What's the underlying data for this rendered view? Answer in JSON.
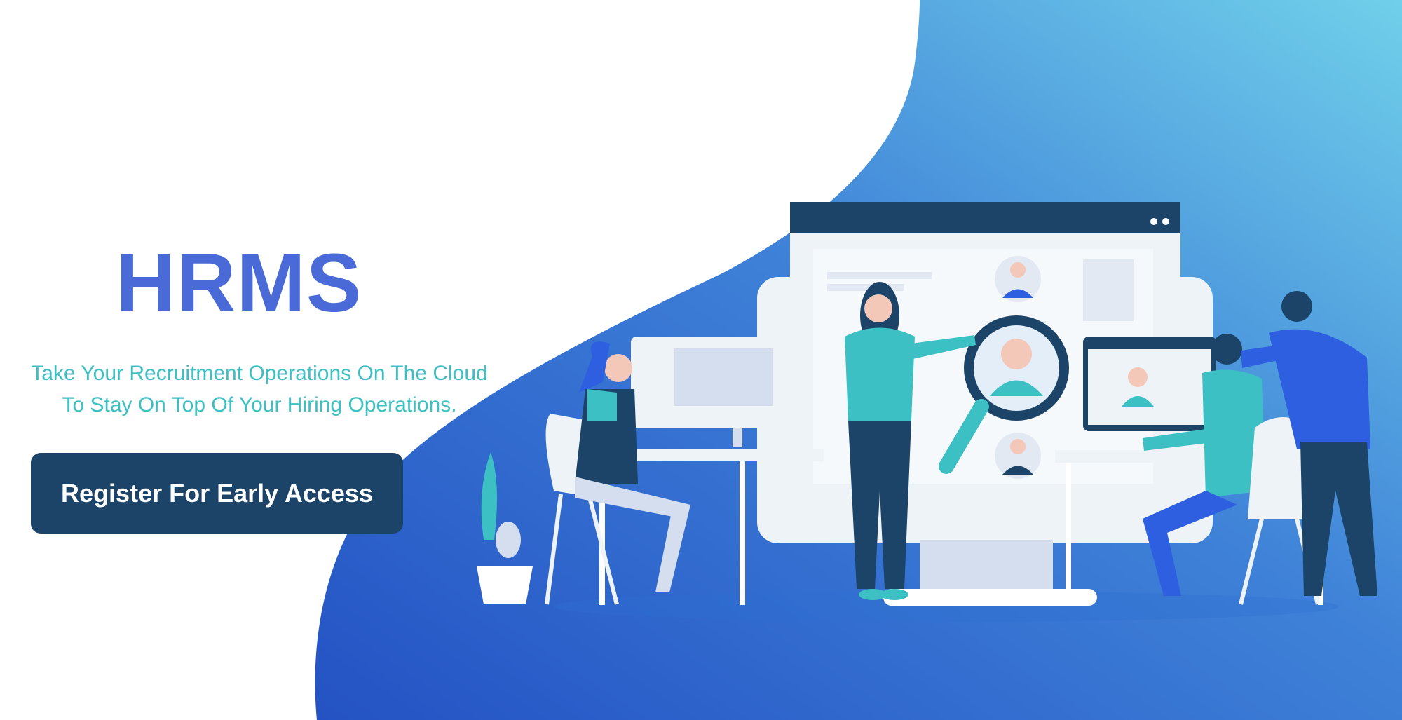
{
  "hero": {
    "title": "HRMS",
    "tagline_line1": "Take Your Recruitment Operations On The Cloud",
    "tagline_line2": "To Stay On Top Of Your Hiring Operations.",
    "cta_label": "Register For Early Access"
  },
  "colors": {
    "title": "#4a6ad8",
    "tagline": "#3cc0c4",
    "cta_background": "#1b4468",
    "blob_gradient_start": "#2452c4",
    "blob_gradient_end": "#70d0ea"
  },
  "illustration": {
    "icons": [
      "desktop-monitor-icon",
      "magnifier-icon",
      "candidate-avatar-icon",
      "plant-icon",
      "desk-icon",
      "chair-icon"
    ]
  }
}
